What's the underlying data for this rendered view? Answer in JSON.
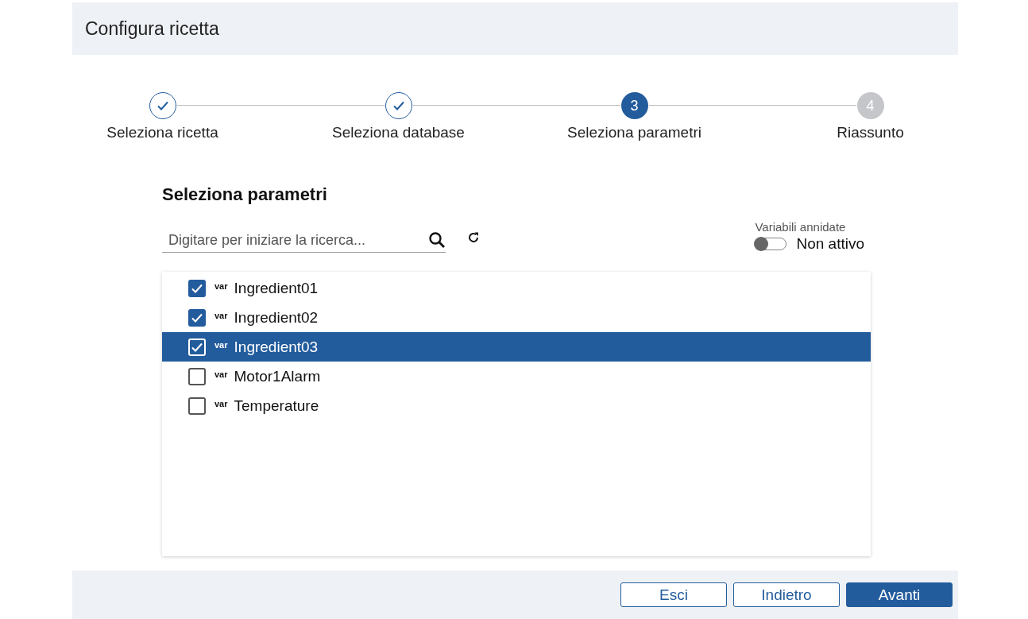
{
  "dialog": {
    "title": "Configura ricetta"
  },
  "steps": [
    {
      "label": "Seleziona ricetta",
      "completed": true,
      "selected": false
    },
    {
      "label": "Seleziona database",
      "completed": true,
      "selected": false
    },
    {
      "number": "3",
      "label": "Seleziona parametri",
      "completed": false,
      "selected": true
    },
    {
      "number": "4",
      "label": "Riassunto",
      "completed": false,
      "selected": false
    }
  ],
  "section": {
    "title": "Seleziona parametri"
  },
  "search": {
    "placeholder": "Digitare per iniziare la ricerca..."
  },
  "nested_toggle": {
    "label": "Variabili annidate",
    "on": false,
    "state_text": "Non attivo"
  },
  "parameters": [
    {
      "tag": "var",
      "name": "Ingredient01",
      "checked": true,
      "selected": false
    },
    {
      "tag": "var",
      "name": "Ingredient02",
      "checked": true,
      "selected": false
    },
    {
      "tag": "var",
      "name": "Ingredient03",
      "checked": true,
      "selected": true
    },
    {
      "tag": "var",
      "name": "Motor1Alarm",
      "checked": false,
      "selected": false
    },
    {
      "tag": "var",
      "name": "Temperature",
      "checked": false,
      "selected": false
    }
  ],
  "buttons": [
    {
      "label": "Esci",
      "kind": "secondary"
    },
    {
      "label": "Indietro",
      "kind": "secondary"
    },
    {
      "label": "Avanti",
      "kind": "primary"
    }
  ]
}
